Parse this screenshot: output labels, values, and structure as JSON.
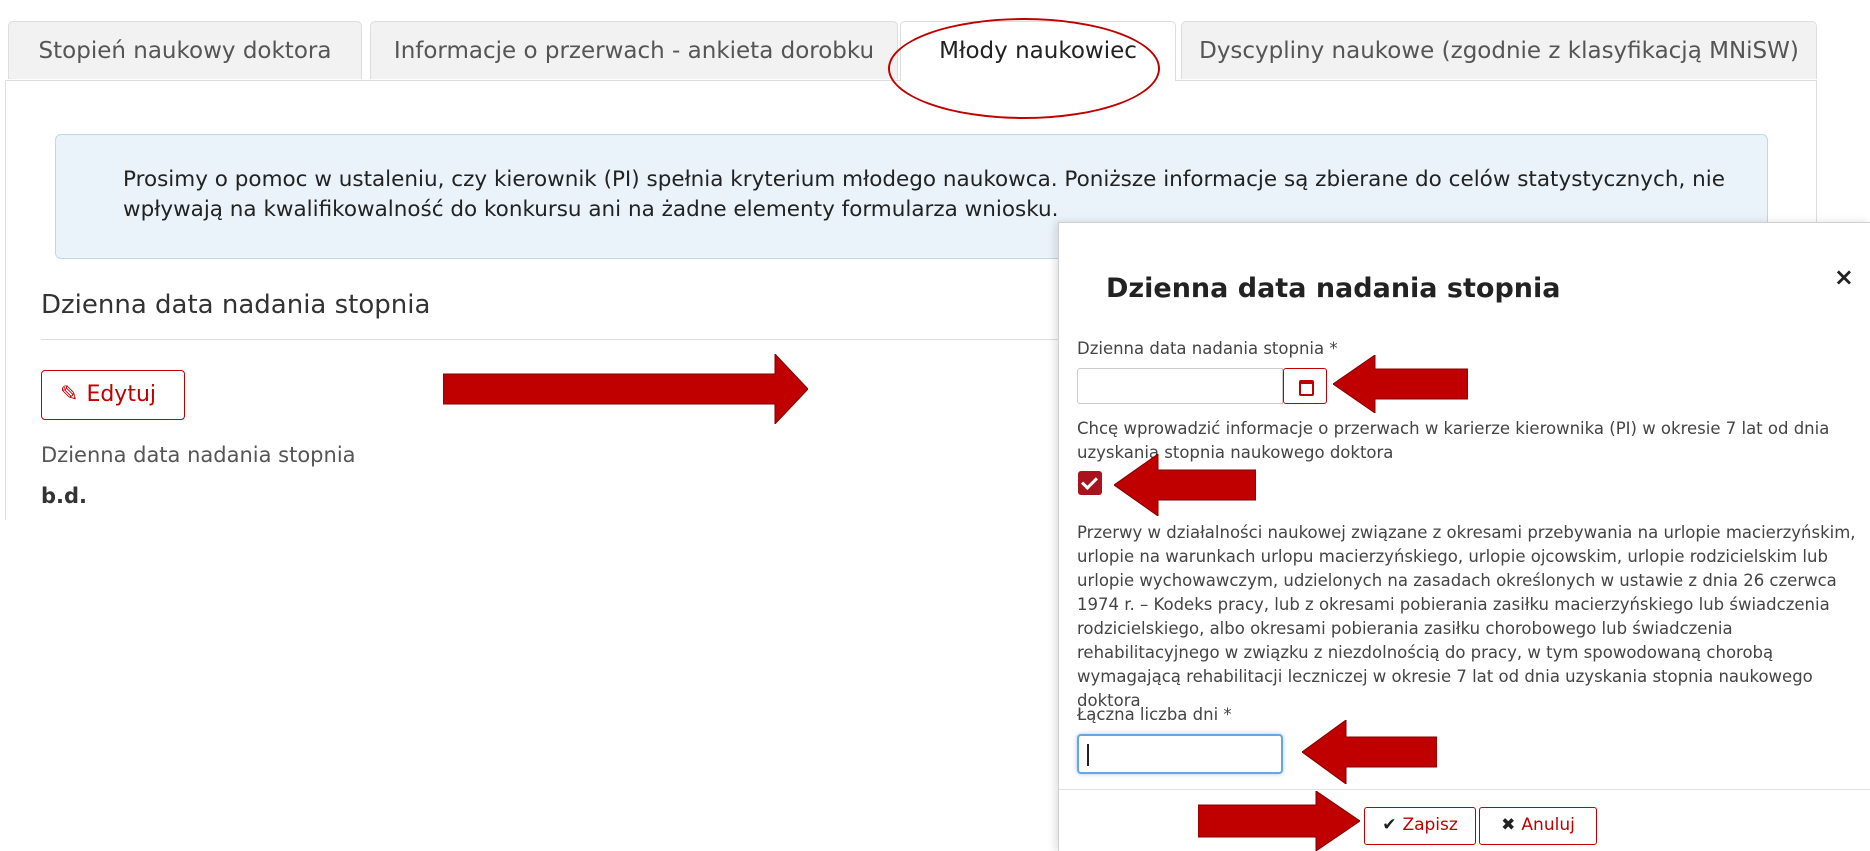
{
  "tabs": [
    {
      "label": "Stopień naukowy doktora"
    },
    {
      "label": "Informacje o przerwach - ankieta dorobku"
    },
    {
      "label": "Młody naukowiec"
    },
    {
      "label": "Dyscypliny naukowe (zgodnie z klasyfikacją MNiSW)"
    }
  ],
  "active_tab": "Młody naukowiec",
  "alert": {
    "text": "Prosimy o pomoc w ustaleniu, czy kierownik (PI) spełnia kryterium młodego naukowca. Poniższe informacje są zbierane do celów statystycznych, nie wpływają na kwalifikowalność do konkursu ani na żadne elementy formularza wniosku."
  },
  "section": {
    "title": "Dzienna data nadania stopnia",
    "edit_label": "Edytuj",
    "field_label": "Dzienna data nadania stopnia",
    "field_value": "b.d."
  },
  "modal": {
    "title": "Dzienna data nadania stopnia",
    "close_symbol": "×",
    "date_label": "Dzienna data nadania stopnia *",
    "checkbox_label": "Chcę wprowadzić informacje o przerwach w karierze kierownika (PI) w okresie 7 lat od dnia uzyskania stopnia naukowego doktora",
    "checkbox_checked": true,
    "breaks_text": "Przerwy w działalności naukowej związane z okresami przebywania na urlopie macierzyńskim, urlopie na warunkach urlopu macierzyńskiego, urlopie ojcowskim, urlopie rodzicielskim lub urlopie wychowawczym, udzielonych na zasadach określonych w ustawie z dnia 26 czerwca 1974 r. – Kodeks pracy, lub z okresami pobierania zasiłku macierzyńskiego lub świadczenia rodzicielskiego, albo okresami pobierania zasiłku chorobowego lub świadczenia rehabilitacyjnego w związku z niezdolnością do pracy, w tym spowodowaną chorobą wymagającą rehabilitacji leczniczej w okresie 7 lat od dnia uzyskania stopnia naukowego doktora",
    "days_label": "Łączna liczba dni *",
    "days_value": "",
    "save_label": "Zapisz",
    "cancel_label": "Anuluj"
  },
  "colors": {
    "accent": "#c00000",
    "alert_bg": "#eaf3f9",
    "checkbox": "#a8131e",
    "focus": "#66a6e8"
  }
}
